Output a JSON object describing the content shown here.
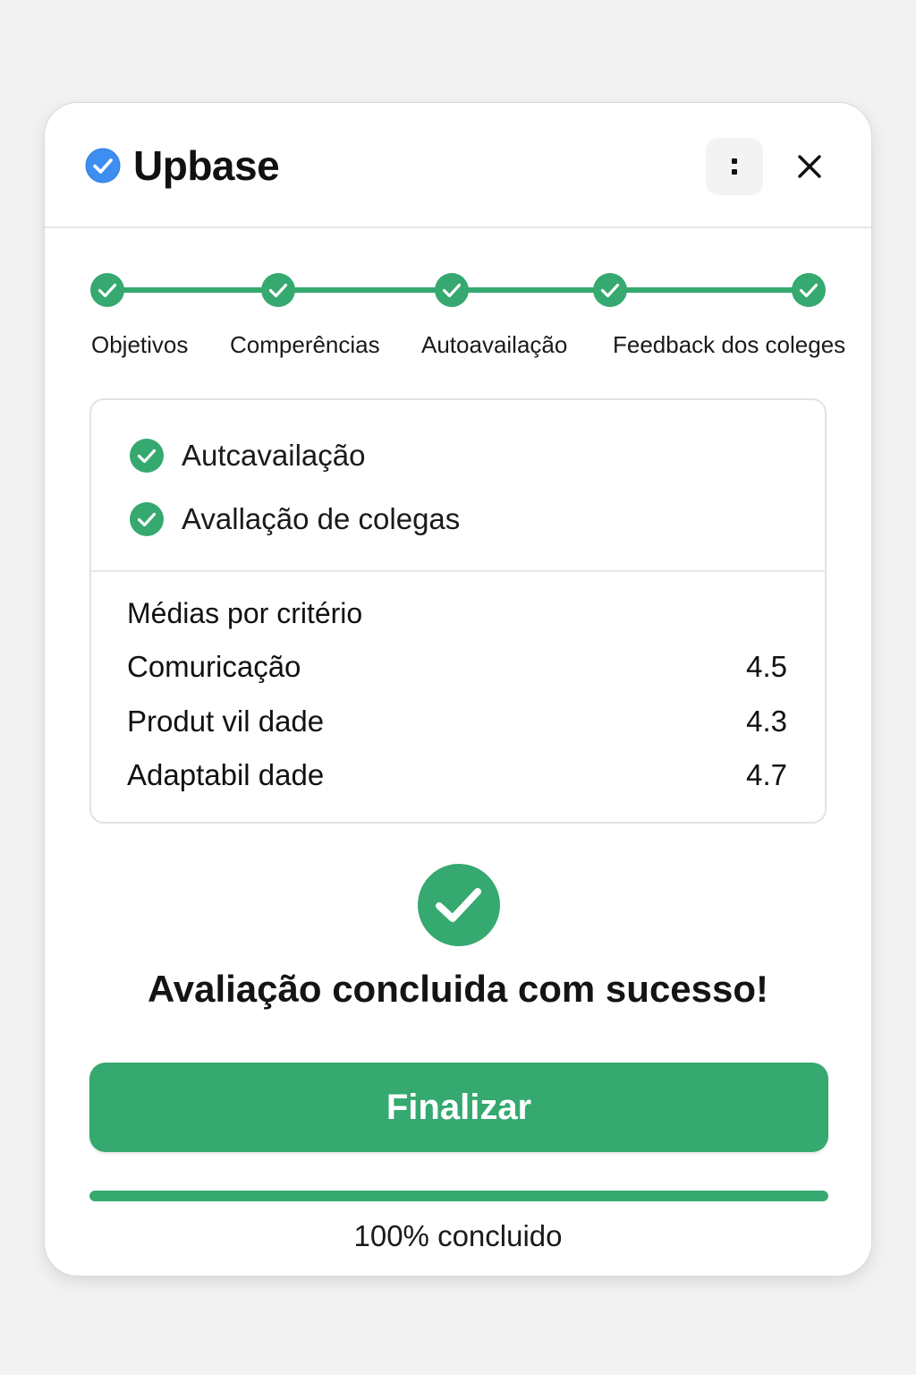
{
  "header": {
    "brand": "Upbase",
    "menu_glyph": ":",
    "close_glyph": "✕"
  },
  "stepper": {
    "steps": [
      {
        "label": "Objetivos",
        "completed": true
      },
      {
        "label": "Comperências",
        "completed": true
      },
      {
        "label": "Autoavailação",
        "completed": true
      },
      {
        "label": "Feedback dos coleges",
        "completed": true
      }
    ]
  },
  "summary": {
    "checks": [
      {
        "label": "Autcavailação",
        "checked": true
      },
      {
        "label": "Avallação de colegas",
        "checked": true
      }
    ],
    "section_title": "Médias por critério",
    "criteria": [
      {
        "name": "Comuricação",
        "value": "4.5"
      },
      {
        "name": "Produt vil dade",
        "value": "4.3"
      },
      {
        "name": "Adaptabil dade",
        "value": "4.7"
      }
    ]
  },
  "success": {
    "message": "Avaliação concluida com sucesso!"
  },
  "actions": {
    "finish_label": "Finalizar"
  },
  "progress": {
    "percent": 100,
    "label": "100% concluido"
  },
  "colors": {
    "accent": "#35a96f",
    "brand_icon": "#3d8ef0",
    "background": "#f2f2f2"
  },
  "icons": {
    "brand": "verified-check-icon",
    "step": "check-circle-icon",
    "success": "check-circle-icon",
    "menu": "more-vertical-icon",
    "close": "close-icon"
  }
}
